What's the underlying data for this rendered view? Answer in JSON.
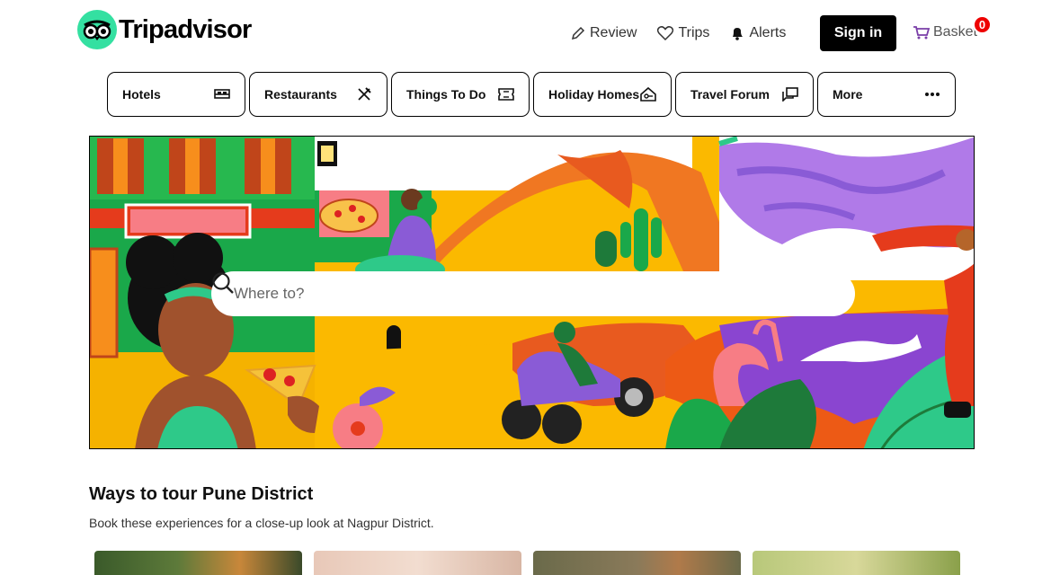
{
  "brand": {
    "name": "Tripadvisor",
    "accent": "#34e0a1"
  },
  "topnav": {
    "review": "Review",
    "trips": "Trips",
    "alerts": "Alerts",
    "signin": "Sign in",
    "basket": "Basket",
    "basket_count": "0"
  },
  "tabs": [
    {
      "label": "Hotels",
      "icon": "bed-icon"
    },
    {
      "label": "Restaurants",
      "icon": "utensils-icon"
    },
    {
      "label": "Things To Do",
      "icon": "ticket-icon"
    },
    {
      "label": "Holiday Homes",
      "icon": "house-key-icon"
    },
    {
      "label": "Travel Forum",
      "icon": "chat-bubbles-icon"
    },
    {
      "label": "More",
      "icon": "ellipsis-icon"
    }
  ],
  "search": {
    "placeholder": "Where to?"
  },
  "section": {
    "title": "Ways to tour Pune District",
    "subtitle": "Book these experiences for a close-up look at Nagpur District."
  },
  "colors": {
    "badge": "#e00000",
    "signin_bg": "#000000"
  }
}
